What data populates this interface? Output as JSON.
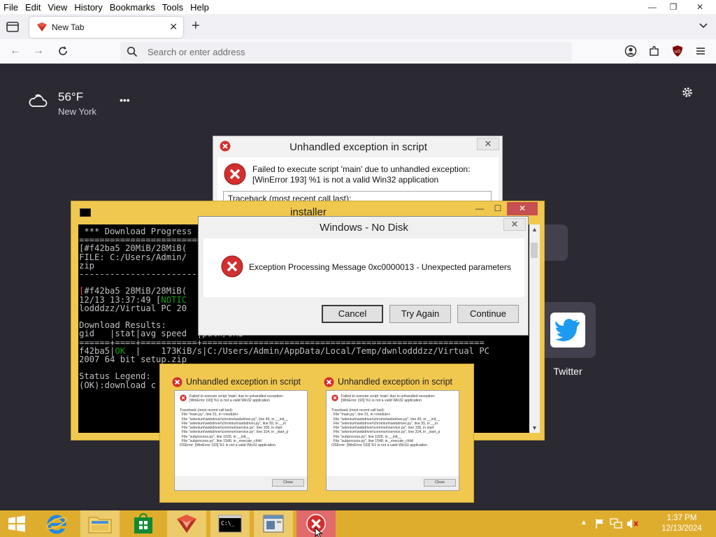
{
  "browser": {
    "menu": [
      "File",
      "Edit",
      "View",
      "History",
      "Bookmarks",
      "Tools",
      "Help"
    ],
    "tab": {
      "title": "New Tab"
    },
    "address": {
      "placeholder": "Search or enter address",
      "value": ""
    }
  },
  "newtab": {
    "weather": {
      "temperature": "56°F",
      "location": "New York"
    },
    "shortcut": {
      "label": "Twitter"
    }
  },
  "dialog_back": {
    "title": "Unhandled exception in script",
    "message_line1": "Failed to execute script 'main' due to unhandled exception:",
    "message_line2": "[WinError 193] %1 is not a valid Win32 application",
    "traceback_header": "Traceback (most recent call last):"
  },
  "installer": {
    "title": "installer",
    "console": {
      "l1": " *** Download Progress",
      "l2": "================================",
      "l3": "[#f42ba5 20MiB/28MiB(",
      "l4": "FILE: C:/Users/Admin/",
      "l5": "zip",
      "l6": "--------------------------------",
      "l8a": "[",
      "l8b": "#f42ba5 28MiB/28MiB(",
      "l9a": "12/13 13:37:49 [",
      "l9b": "NOTIC",
      "l10": "lodddzz/Virtual PC 20",
      "l12": "Download Results:",
      "l13": "gid   |stat|avg speed  |path/URI",
      "l14": "======+====+===========+=======================================================",
      "l15a": "f42ba5|",
      "l15b": "OK",
      "l15c": "  |    173KiB/s|C:/Users/Admin/AppData/Local/Temp/dwnlodddzz/Virtual PC",
      "l16": "2007 64 bit setup.zip",
      "l18": "Status Legend:",
      "l19": "(OK):download c"
    }
  },
  "dialog_front": {
    "title": "Windows - No Disk",
    "message": "Exception Processing Message 0xc0000013 - Unexpected parameters",
    "buttons": {
      "cancel": "Cancel",
      "try_again": "Try Again",
      "continue": "Continue"
    }
  },
  "mini_dialogs": {
    "title": "Unhandled exception in script",
    "message": "Failed to execute script 'main' due to unhandled exception:\n[WinError 193] %1 is not a valid Win32 application",
    "traceback": "Traceback (most recent call last):\n  File \"main.py\", line 31, in <module>\n  File \"selenium\\webdriver\\chrome\\webdriver.py\", line 45, in __init__\n  File \"selenium\\webdriver\\chromium\\webdriver.py\", line 55, in __in\n  File \"selenium\\webdriver\\common\\service.py\", line 106, in start\n  File \"selenium\\webdriver\\common\\service.py\", line 314, in _start_p\n  File \"subprocess.py\", line 1026, in __init__\n  File \"subprocess.py\", line 1548, in _execute_child\nOSError: [WinError 193] %1 is not a valid Win32 application",
    "close": "Close"
  },
  "taskbar": {
    "clock_time": "1:37 PM",
    "clock_date": "12/13/2024"
  },
  "colors": {
    "taskbar": "#dfad2e",
    "window_frame": "#f1c84f",
    "newtab_bg": "#2b2a33",
    "error_red": "#d22f2f",
    "console_ok": "#13a10e",
    "console_err": "#e74856"
  },
  "icons": {
    "weather": "cloud-icon",
    "error": "error-x-icon",
    "twitter": "twitter-bird-icon",
    "start": "windows-logo-icon"
  }
}
